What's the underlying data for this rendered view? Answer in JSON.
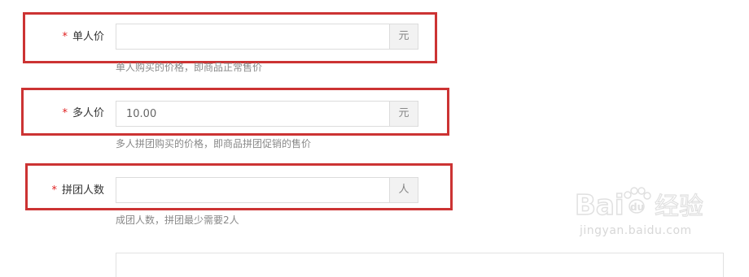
{
  "fields": [
    {
      "label": "单人价",
      "required_mark": "*",
      "value": "",
      "suffix": "元",
      "hint": "单人购买的价格，即商品正常售价"
    },
    {
      "label": "多人价",
      "required_mark": "*",
      "value": "10.00",
      "suffix": "元",
      "hint": "多人拼团购买的价格，即商品拼团促销的售价"
    },
    {
      "label": "拼团人数",
      "required_mark": "*",
      "value": "",
      "suffix": "人",
      "hint": "成团人数，拼团最少需要2人"
    }
  ],
  "watermark": {
    "brand": "Baidu经验",
    "url": "jingyan.baidu.com"
  },
  "colors": {
    "highlight": "#cc3333",
    "required": "#e02020"
  }
}
